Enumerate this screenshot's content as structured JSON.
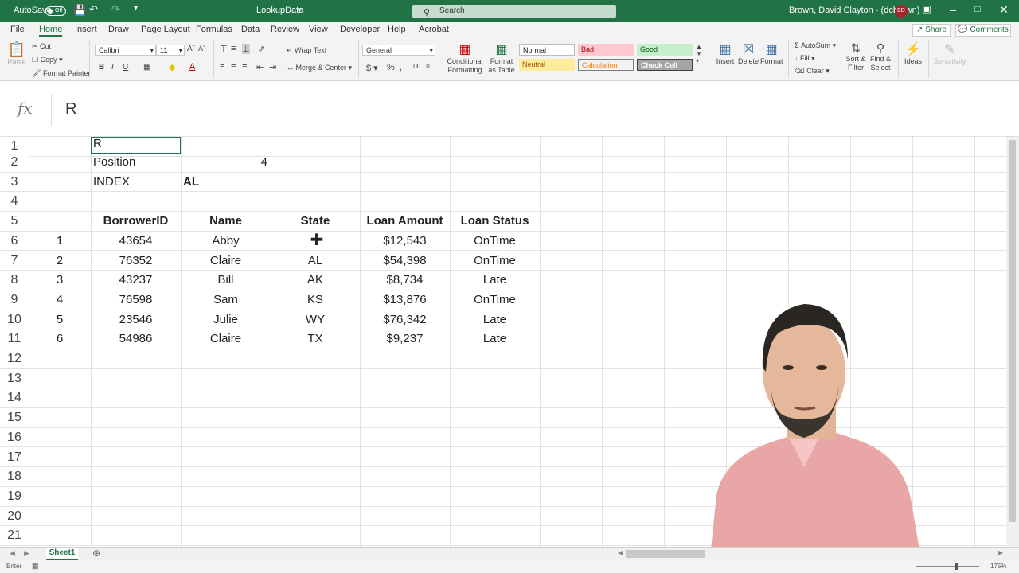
{
  "titlebar": {
    "autosave_label": "AutoSave",
    "autosave_state": "Off",
    "file_name": "LookupData",
    "search_placeholder": "Search",
    "user_name": "Brown, David Clayton - (dcbrown)",
    "user_initials": "BD",
    "accent": "#217346"
  },
  "tabs": [
    "File",
    "Home",
    "Insert",
    "Draw",
    "Page Layout",
    "Formulas",
    "Data",
    "Review",
    "View",
    "Developer",
    "Help",
    "Acrobat"
  ],
  "active_tab": "Home",
  "share_label": "Share",
  "comments_label": "Comments",
  "ribbon": {
    "paste": "Paste",
    "cut": "Cut",
    "copy": "Copy",
    "format_painter": "Format Painter",
    "font_name": "Calibri",
    "font_size": "11",
    "wrap_text": "Wrap Text",
    "merge_center": "Merge & Center",
    "number_format": "General",
    "conditional_formatting": "Conditional Formatting",
    "format_as_table": "Format as Table",
    "styles": {
      "normal": "Normal",
      "bad": "Bad",
      "good": "Good",
      "neutral": "Neutral",
      "calculation": "Calculation",
      "check_cell": "Check Cell"
    },
    "insert": "Insert",
    "delete": "Delete",
    "format": "Format",
    "autosum": "AutoSum",
    "fill": "Fill",
    "clear": "Clear",
    "sort_filter": "Sort & Filter",
    "find_select": "Find & Select",
    "ideas": "Ideas",
    "sensitivity": "Sensitivity"
  },
  "formula_bar": {
    "fx": "fx",
    "value": "R"
  },
  "sheet": {
    "row_numbers": [
      "1",
      "2",
      "3",
      "4",
      "5",
      "6",
      "7",
      "8",
      "9",
      "10",
      "11",
      "12",
      "13",
      "14",
      "15",
      "16",
      "17",
      "18",
      "19",
      "20",
      "21"
    ],
    "b1": "R",
    "b2": "Position",
    "c2": "4",
    "b3": "INDEX",
    "c3": "AL",
    "headers": [
      "BorrowerID",
      "Name",
      "State",
      "Loan Amount",
      "Loan Status"
    ],
    "rows": [
      {
        "idx": "1",
        "id": "43654",
        "name": "Abby",
        "state": "",
        "amount": "$12,543",
        "status": "OnTime"
      },
      {
        "idx": "2",
        "id": "76352",
        "name": "Claire",
        "state": "AL",
        "amount": "$54,398",
        "status": "OnTime"
      },
      {
        "idx": "3",
        "id": "43237",
        "name": "Bill",
        "state": "AK",
        "amount": "$8,734",
        "status": "Late"
      },
      {
        "idx": "4",
        "id": "76598",
        "name": "Sam",
        "state": "KS",
        "amount": "$13,876",
        "status": "OnTime"
      },
      {
        "idx": "5",
        "id": "23546",
        "name": "Julie",
        "state": "WY",
        "amount": "$76,342",
        "status": "Late"
      },
      {
        "idx": "6",
        "id": "54986",
        "name": "Claire",
        "state": "TX",
        "amount": "$9,237",
        "status": "Late"
      }
    ]
  },
  "sheet_tab": "Sheet1",
  "status_mode": "Enter",
  "zoom": "175%"
}
